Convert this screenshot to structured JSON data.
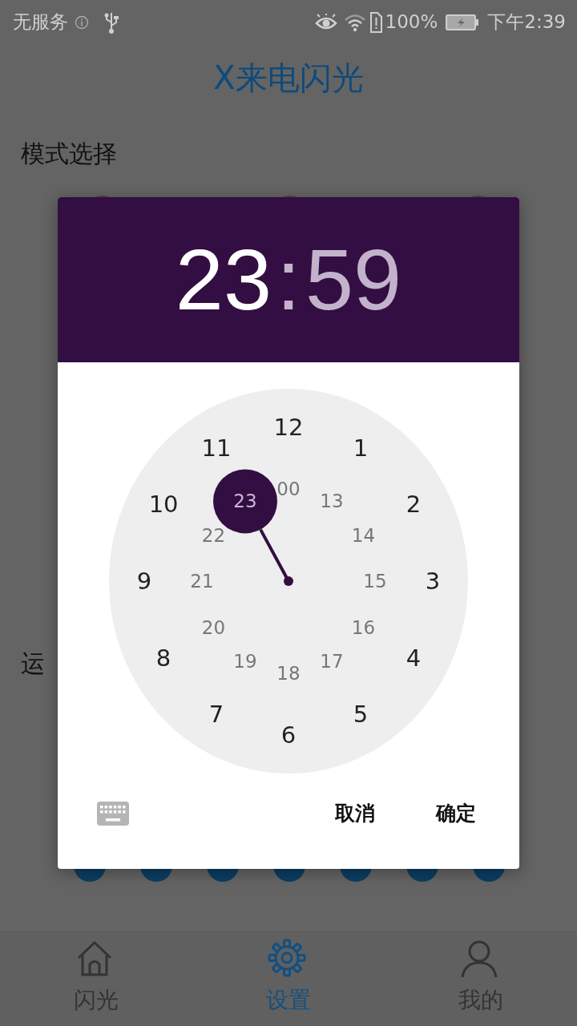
{
  "status_bar": {
    "carrier": "无服务",
    "battery": "100%",
    "time": "下午2:39"
  },
  "app": {
    "title": "X来电闪光",
    "section_1": "模式选择",
    "section_2": "运"
  },
  "dialog": {
    "hour": "23",
    "separator": ":",
    "minute": "59",
    "hour_selected": true,
    "clock": {
      "outer": [
        {
          "label": "12",
          "selected": false
        },
        {
          "label": "1",
          "selected": false
        },
        {
          "label": "2",
          "selected": false
        },
        {
          "label": "3",
          "selected": false
        },
        {
          "label": "4",
          "selected": false
        },
        {
          "label": "5",
          "selected": false
        },
        {
          "label": "6",
          "selected": false
        },
        {
          "label": "7",
          "selected": false
        },
        {
          "label": "8",
          "selected": false
        },
        {
          "label": "9",
          "selected": false
        },
        {
          "label": "10",
          "selected": false
        },
        {
          "label": "11",
          "selected": false
        }
      ],
      "inner": [
        {
          "label": "00",
          "selected": false
        },
        {
          "label": "13",
          "selected": false
        },
        {
          "label": "14",
          "selected": false
        },
        {
          "label": "15",
          "selected": false
        },
        {
          "label": "16",
          "selected": false
        },
        {
          "label": "17",
          "selected": false
        },
        {
          "label": "18",
          "selected": false
        },
        {
          "label": "19",
          "selected": false
        },
        {
          "label": "20",
          "selected": false
        },
        {
          "label": "21",
          "selected": false
        },
        {
          "label": "22",
          "selected": false
        },
        {
          "label": "23",
          "selected": true
        }
      ]
    },
    "buttons": [
      "取消",
      "确定"
    ]
  },
  "tabs": [
    {
      "label": "闪光",
      "selected": false,
      "kind": "home"
    },
    {
      "label": "设置",
      "selected": true,
      "kind": "settings"
    },
    {
      "label": "我的",
      "selected": false,
      "kind": "person"
    }
  ]
}
